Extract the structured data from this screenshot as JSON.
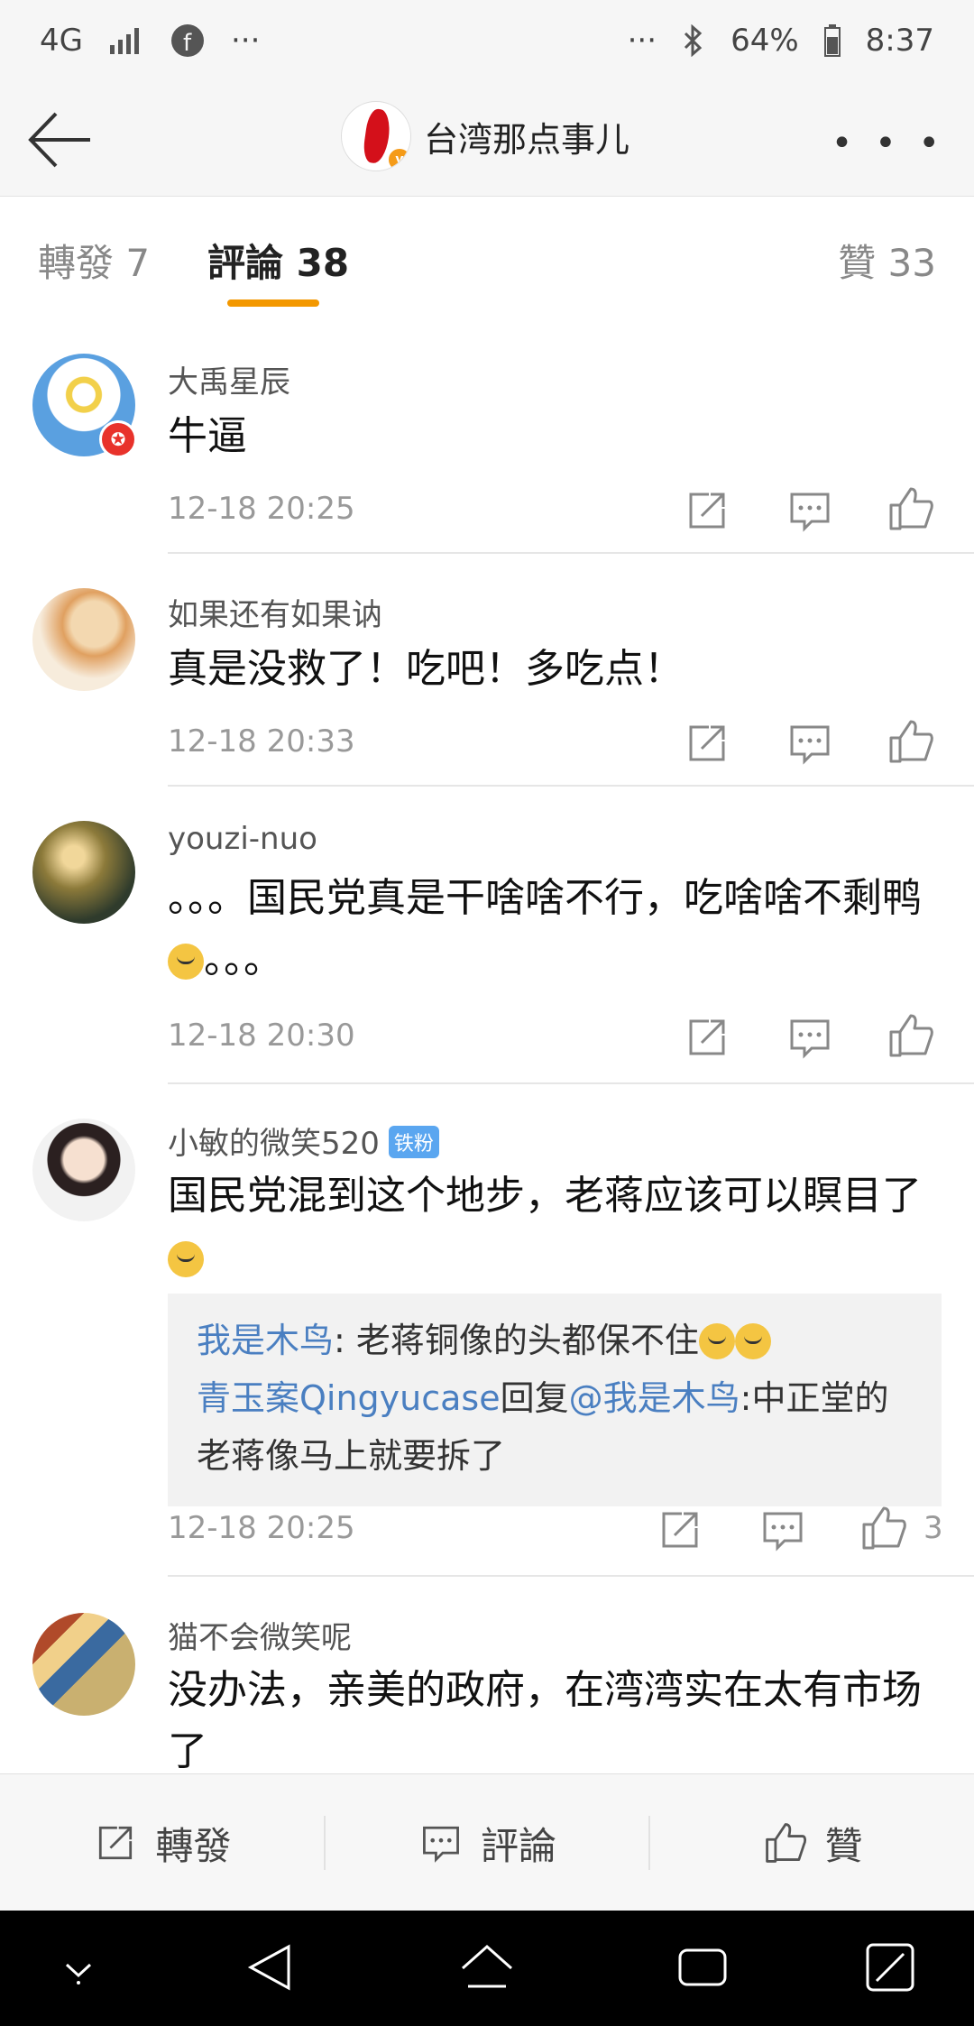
{
  "status_bar": {
    "network": "4G",
    "left_icons": [
      "signal-icon",
      "facebook-icon",
      "more-dots-icon"
    ],
    "right_dots": "···",
    "battery": "64%",
    "time": "8:37"
  },
  "header": {
    "back_icon": "back-arrow-icon",
    "title": "台湾那点事儿",
    "more": "• • •"
  },
  "tabs": [
    {
      "label": "轉發 7"
    },
    {
      "label": "評論 38"
    },
    {
      "label": "贊 33"
    }
  ],
  "comments": [
    {
      "user": "大禹星辰",
      "text": "牛逼",
      "time": "12-18 20:25"
    },
    {
      "user": "如果还有如果讷",
      "text": "真是没救了！吃吧！多吃点！",
      "time": "12-18 20:33"
    },
    {
      "user": "youzi-nuo",
      "text": "。。。国民党真是干啥啥不行，吃啥啥不剩鸭",
      "text_end": "。。。",
      "time": "12-18 20:30"
    },
    {
      "user": "小敏的微笑520",
      "fan_badge": "铁粉",
      "text": "国民党混到这个地步，老蒋应该可以瞑目了",
      "time": "12-18 20:25",
      "likes": "3",
      "replies": [
        {
          "user": "我是木鸟",
          "sep": ": ",
          "text": "老蒋铜像的头都保不住"
        },
        {
          "user": "青玉案Qingyucase",
          "mid": "回复",
          "mention": "@我是木鸟",
          "text": ":中正堂的老蒋像马上就要拆了"
        }
      ]
    },
    {
      "user": "猫不会微笑呢",
      "text": "没办法，亲美的政府，在湾湾实在太有市场了",
      "time": ""
    }
  ],
  "bottom_bar": {
    "repost": "轉發",
    "comment": "評論",
    "like": "贊"
  }
}
